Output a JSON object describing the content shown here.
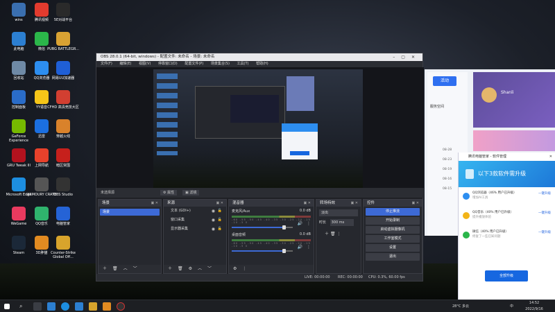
{
  "desktop_icons": [
    {
      "label": "wins",
      "color": "#3a6fb0"
    },
    {
      "label": "腾讯视频",
      "color": "#e23b2e"
    },
    {
      "label": "5E对战平台",
      "color": "#2a2a2a"
    },
    {
      "label": "此电脑",
      "color": "#2c7fd1"
    },
    {
      "label": "微信",
      "color": "#2bb64a"
    },
    {
      "label": "PUBG BATTLEGR...",
      "color": "#d9a233"
    },
    {
      "label": "回收站",
      "color": "#6f8aa6"
    },
    {
      "label": "QQ浏览器",
      "color": "#2d8ef0"
    },
    {
      "label": "网易UU加速器",
      "color": "#1f5fd6"
    },
    {
      "label": "控制面板",
      "color": "#2a6cc8"
    },
    {
      "label": "YY语音",
      "color": "#f5c518"
    },
    {
      "label": "CFHD 高清竞技大区",
      "color": "#d23f31"
    },
    {
      "label": "GeForce Experience",
      "color": "#76b900"
    },
    {
      "label": "迅雷",
      "color": "#1b6fe0"
    },
    {
      "label": "穿越火线",
      "color": "#d9822b"
    },
    {
      "label": "GRU Tweak III",
      "color": "#b3121e"
    },
    {
      "label": "上网导航",
      "color": "#e8412b"
    },
    {
      "label": "暗区突围",
      "color": "#c6201c"
    },
    {
      "label": "Microsoft Edge",
      "color": "#1d8ee0"
    },
    {
      "label": "ARMOURY CRATE",
      "color": "#555"
    },
    {
      "label": "OBS Studio",
      "color": "#333"
    },
    {
      "label": "WeGame",
      "color": "#e93a5f"
    },
    {
      "label": "QQ音乐",
      "color": "#2fb36d"
    },
    {
      "label": "电脑管家",
      "color": "#2563d6"
    },
    {
      "label": "Steam",
      "color": "#1b2838"
    },
    {
      "label": "3D胖猫",
      "color": "#e28b21"
    },
    {
      "label": "Counter-Strike Global Off...",
      "color": "#d8a42c"
    }
  ],
  "obs": {
    "title": "OBS 28.0.1 (64-bit, windows) - 配置文件: 未命名 - 场景: 未命名",
    "menu": [
      "文件(F)",
      "编辑(E)",
      "视图(V)",
      "停靠窗口(D)",
      "配置文件(P)",
      "场景集合(S)",
      "工具(T)",
      "帮助(H)"
    ],
    "no_source": "未选择源",
    "props_btn": "属性",
    "filter_btn": "滤镜",
    "scenes": {
      "title": "场景",
      "items": [
        "场景"
      ]
    },
    "sources": {
      "title": "来源",
      "items": [
        "文本 (GDI+)",
        "窗口采集",
        "显示器采集"
      ]
    },
    "mixer": {
      "title": "混音器",
      "tracks": [
        {
          "name": "麦克风/Aux",
          "db": "0.0 dB",
          "level": 0.85,
          "scale": "-60 -55 -50 -45 -40 -35 -30 -25 -20 -15 -10 -5 0"
        },
        {
          "name": "桌面音频",
          "db": "0.0 dB",
          "level": 0.85,
          "scale": "-60 -55 -50 -45 -40 -35 -30 -25 -20 -15 -10 -5 0"
        }
      ]
    },
    "transitions": {
      "title": "转场特效",
      "type": "淡出",
      "duration_label": "时长",
      "duration": "300 ms"
    },
    "controls": {
      "title": "控件",
      "buttons": [
        "停止推流",
        "开始录制",
        "启动虚拟摄像机",
        "工作室模式",
        "设置",
        "退出"
      ]
    },
    "status": {
      "live": "LIVE: 00:00:00",
      "rec": "REC: 00:00:00",
      "cpu": "CPU: 0.3%, 60.00 fps"
    }
  },
  "right_panel": {
    "tab": "活动",
    "user": "Shanli",
    "service": "服务空间",
    "times": [
      "08-28",
      "08-23",
      "08-19",
      "08-16",
      "08-15"
    ]
  },
  "popup": {
    "header": "腾讯电脑管家 - 软件管理",
    "banner": "以下3款软件需升级",
    "apps": [
      {
        "name": "QQ浏览器（46% 用户已升级）",
        "sub": "增加AI工具",
        "action": "一键升级",
        "color": "#2d8ef0"
      },
      {
        "name": "QQ音乐（40% 用户已升级）",
        "sub": "提升播放体验",
        "action": "一键升级",
        "color": "#f2b418"
      },
      {
        "name": "微信（40% 用户已升级）",
        "sub": "修复了一些已知问题",
        "action": "一键升级",
        "color": "#2bb64a"
      }
    ],
    "button": "全部升级"
  },
  "taskbar": {
    "weather": "28°C 多云",
    "time": "14:52",
    "date": "2022/9/16",
    "ime": "中"
  }
}
